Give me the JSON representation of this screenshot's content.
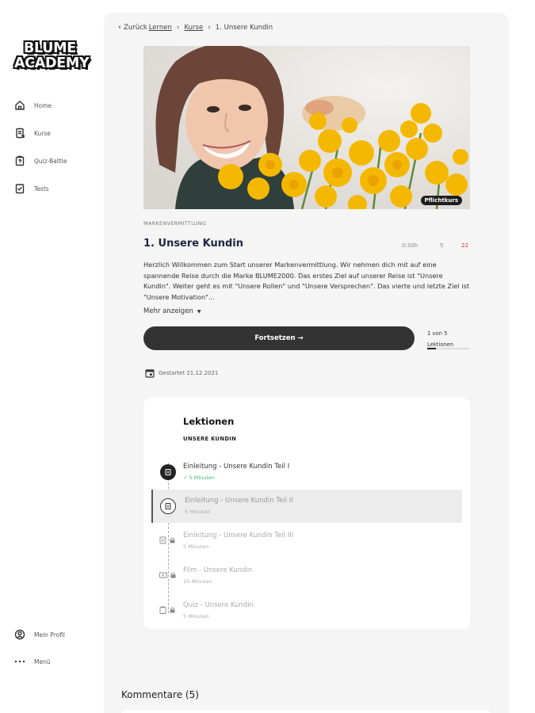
{
  "sidebar": {
    "logo": {
      "line1": "BLUME",
      "line2": "ACADEMY"
    },
    "items": [
      {
        "label": "Home",
        "icon": "home-icon"
      },
      {
        "label": "Kurse",
        "icon": "courses-icon"
      },
      {
        "label": "Quiz-Battle",
        "icon": "quiz-battle-icon"
      },
      {
        "label": "Tests",
        "icon": "tests-icon"
      }
    ],
    "profile": {
      "label": "Mein Profil",
      "icon": "profile-icon"
    },
    "menu": {
      "label": "Menü",
      "icon": "more-dots-icon"
    }
  },
  "breadcrumb": {
    "back_prefix": "Zurück",
    "back_link": "Lernen",
    "courses": "Kurse",
    "current": "1. Unsere Kundin"
  },
  "hero": {
    "badge": "Pflichtkurs"
  },
  "course": {
    "category": "MARKENVERMITTLUNG",
    "title": "1. Unsere Kundin",
    "duration": "0:30h",
    "lessons_count": "5",
    "points": "22",
    "description": "Herzlich Willkommen zum Start unserer Markenvermittlung. Wir nehmen dich mit auf eine spannende Reise durch die Marke BLUME2000. Das erstes Ziel auf unserer Reise ist \"Unsere Kundin\". Weiter geht es mit \"Unsere Rollen\" und \"Unsere Versprechen\". Das vierte und letzte Ziel ist \"Unsere Motivation\"...",
    "show_more": "Mehr anzeigen",
    "continue_label": "Fortsetzen →",
    "progress_line1": "1 von 5",
    "progress_line2": "Lektionen",
    "progress_fraction": 0.2,
    "started": "Gestartet 21.12.2021"
  },
  "lessons": {
    "heading": "Lektionen",
    "section": "UNSERE KUNDIN",
    "items": [
      {
        "title": "Einleitung - Unsere Kundin Teil I",
        "sub": "✓ 5 Minuten",
        "state": "done"
      },
      {
        "title": "Einleitung - Unsere Kundin Teil II",
        "sub": "5 Minuten",
        "state": "active"
      },
      {
        "title": "Einleitung - Unsere Kundin Teil III",
        "sub": "5 Minuten",
        "state": "locked"
      },
      {
        "title": "Film - Unsere Kundin",
        "sub": "10 Minuten",
        "state": "locked"
      },
      {
        "title": "Quiz - Unsere Kundin",
        "sub": "5 Minuten",
        "state": "locked"
      }
    ]
  },
  "comments": {
    "heading": "Kommentare (5)"
  },
  "colors": {
    "accent_dark": "#333333",
    "success": "#3dba7a",
    "points_red": "#e0323c",
    "title_navy": "#1c2543"
  }
}
